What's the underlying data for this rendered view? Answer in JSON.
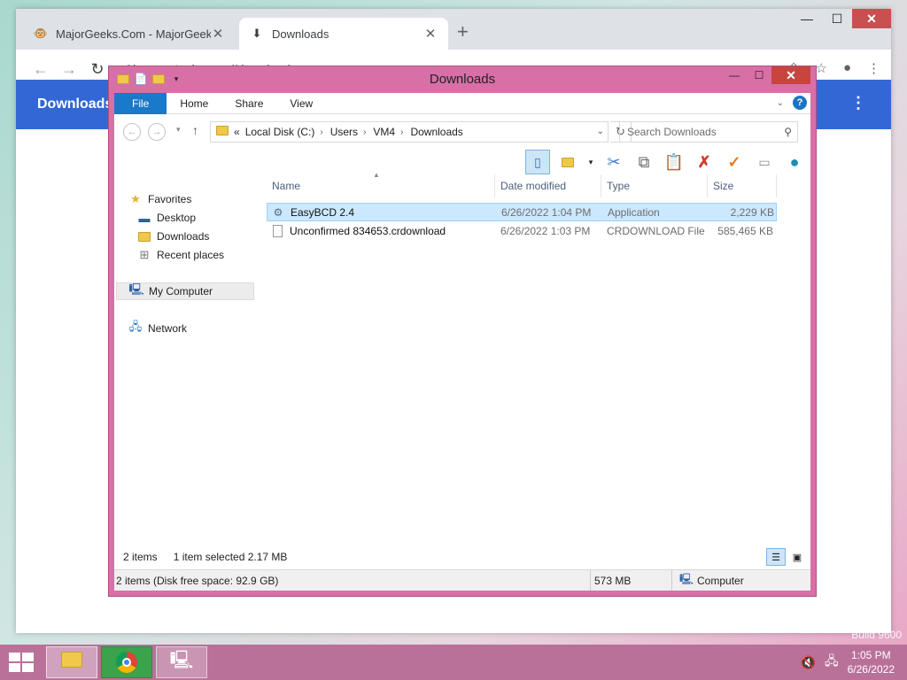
{
  "chrome": {
    "tabs": [
      {
        "title": "MajorGeeks.Com - MajorGeeks",
        "icon": "majorgeeks-favicon"
      },
      {
        "title": "Downloads",
        "icon": "download-icon"
      }
    ],
    "site_label": "Chrome",
    "url": "chrome://downloads",
    "page_title": "Downloads"
  },
  "explorer": {
    "window_title": "Downloads",
    "ribbon_tabs": [
      "File",
      "Home",
      "Share",
      "View"
    ],
    "breadcrumb": {
      "prefix": "«",
      "parts": [
        "Local Disk (C:)",
        "Users",
        "VM4",
        "Downloads"
      ]
    },
    "search_placeholder": "Search Downloads",
    "nav": {
      "favorites": "Favorites",
      "desktop": "Desktop",
      "downloads": "Downloads",
      "recent": "Recent places",
      "computer": "My Computer",
      "network": "Network"
    },
    "columns": [
      "Name",
      "Date modified",
      "Type",
      "Size"
    ],
    "files": [
      {
        "name": "EasyBCD 2.4",
        "date": "6/26/2022 1:04 PM",
        "type": "Application",
        "size": "2,229 KB",
        "icon": "application-icon",
        "selected": true
      },
      {
        "name": "Unconfirmed 834653.crdownload",
        "date": "6/26/2022 1:03 PM",
        "type": "CRDOWNLOAD File",
        "size": "585,465 KB",
        "icon": "document-icon",
        "selected": false
      }
    ],
    "status": {
      "items": "2 items",
      "selected": "1 item selected  2.17 MB",
      "details": "2 items (Disk free space: 92.9 GB)",
      "size": "573 MB",
      "location": "Computer"
    }
  },
  "taskbar": {
    "time": "1:05 PM",
    "date": "6/26/2022"
  },
  "desktop": {
    "watermark": "Build 9600"
  }
}
